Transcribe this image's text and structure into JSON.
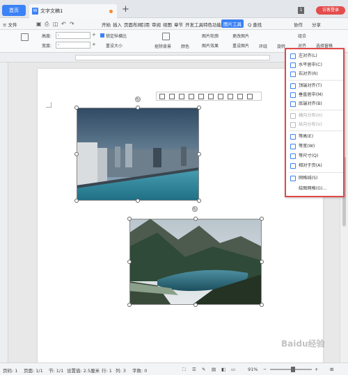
{
  "tabs": {
    "home": "首页",
    "document": "文字文稿1",
    "new_tab": "+",
    "window_count": "1",
    "login": "访客登录"
  },
  "menubar": {
    "file": "≡ 文件",
    "items": [
      "开始",
      "插入",
      "页面布局",
      "引用",
      "审阅",
      "视图",
      "章节",
      "开发工具",
      "特色功能",
      "图片工具"
    ],
    "search": "Q 查找",
    "collab": "协作",
    "share": "分享"
  },
  "ribbon": {
    "height_label": "高度:",
    "width_label": "宽度:",
    "height_value": "-",
    "width_value": "-",
    "lock_ratio": "锁定纵横比",
    "reset_size": "重设大小",
    "remove_bg": "抠除背景",
    "color": "颜色",
    "outline": "图片轮廓",
    "effect": "图片效果",
    "change_img": "更改图片",
    "reset_img": "重设图片",
    "wrap": "环绕",
    "rotate": "旋转",
    "group": "组合",
    "select_pane": "选择窗格",
    "align": "对齐"
  },
  "align_menu": {
    "items": [
      {
        "label": "左对齐(L)",
        "enabled": true,
        "icon": "align-left-icon"
      },
      {
        "label": "水平居中(C)",
        "enabled": true,
        "icon": "align-center-icon"
      },
      {
        "label": "右对齐(R)",
        "enabled": true,
        "icon": "align-right-icon"
      },
      {
        "label": "顶端对齐(T)",
        "enabled": true,
        "icon": "align-top-icon"
      },
      {
        "label": "垂直居中(M)",
        "enabled": true,
        "icon": "align-middle-icon"
      },
      {
        "label": "底端对齐(B)",
        "enabled": true,
        "icon": "align-bottom-icon"
      },
      {
        "label": "横向分布(H)",
        "enabled": false,
        "icon": "distribute-horizontal-icon"
      },
      {
        "label": "纵向分布(V)",
        "enabled": false,
        "icon": "distribute-vertical-icon"
      },
      {
        "label": "等高(E)",
        "enabled": true,
        "icon": "same-height-icon"
      },
      {
        "label": "等宽(W)",
        "enabled": true,
        "icon": "same-width-icon"
      },
      {
        "label": "等尺寸(Q)",
        "enabled": true,
        "icon": "same-size-icon"
      },
      {
        "label": "相对于页(A)",
        "enabled": true,
        "icon": "relative-page-icon"
      },
      {
        "label": "网格线(S)",
        "enabled": true,
        "icon": "gridlines-icon"
      },
      {
        "label": "绘图网格(G)...",
        "enabled": true,
        "icon": ""
      }
    ]
  },
  "statusbar": {
    "page": "页码: 1",
    "pages": "页面: 1/1",
    "section": "节: 1/1",
    "setting": "设置值: 2.5厘米",
    "row": "行: 1",
    "col": "列: 3",
    "chars": "字数: 0",
    "zoom": "91%"
  },
  "watermark": "Baidu经验"
}
